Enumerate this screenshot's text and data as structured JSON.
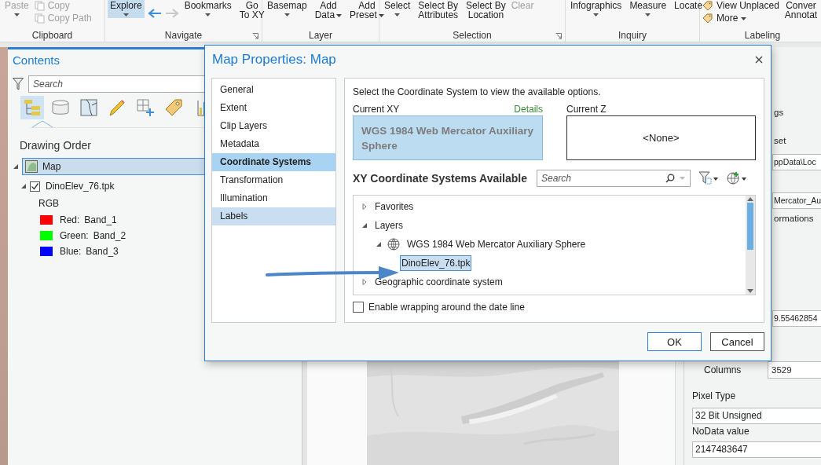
{
  "ribbon": {
    "groups": [
      {
        "label": "Clipboard",
        "launcher": false,
        "items": [
          {
            "kind": "menu",
            "label": "Paste",
            "disabled": true,
            "selected": false
          },
          {
            "kind": "stack",
            "entries": [
              {
                "kind": "button",
                "label": "Copy",
                "disabled": true
              },
              {
                "kind": "button",
                "label": "Copy Path",
                "disabled": true
              }
            ]
          }
        ]
      },
      {
        "label": "Navigate",
        "launcher": true,
        "items": [
          {
            "kind": "menu",
            "label": "Explore",
            "disabled": false,
            "selected": true
          },
          {
            "kind": "history",
            "back_disabled": false,
            "forward_disabled": true
          },
          {
            "kind": "menu",
            "label": "Bookmarks",
            "disabled": false,
            "selected": false
          },
          {
            "kind": "button",
            "label": "Go\nTo XY",
            "disabled": false,
            "selected": false
          }
        ]
      },
      {
        "label": "Layer",
        "launcher": false,
        "items": [
          {
            "kind": "menu",
            "label": "Basemap",
            "disabled": false,
            "selected": false
          },
          {
            "kind": "dropdown",
            "label": "Add\nData",
            "disabled": false,
            "selected": false
          },
          {
            "kind": "dropdown",
            "label": "Add\nPreset",
            "disabled": false,
            "selected": false
          }
        ]
      },
      {
        "label": "Selection",
        "launcher": true,
        "items": [
          {
            "kind": "menu",
            "label": "Select",
            "disabled": false,
            "selected": false
          },
          {
            "kind": "button",
            "label": "Select By\nAttributes",
            "disabled": false,
            "selected": false
          },
          {
            "kind": "button",
            "label": "Select By\nLocation",
            "disabled": false,
            "selected": false
          },
          {
            "kind": "stack",
            "entries": [
              {
                "kind": "button",
                "label": "Clear",
                "disabled": true
              }
            ]
          }
        ]
      },
      {
        "label": "Inquiry",
        "launcher": false,
        "items": [
          {
            "kind": "menu",
            "label": "Infographics",
            "disabled": false,
            "selected": false
          },
          {
            "kind": "menu",
            "label": "Measure",
            "disabled": false,
            "selected": false
          },
          {
            "kind": "button",
            "label": "Locate",
            "disabled": false,
            "selected": false
          }
        ]
      },
      {
        "label": "Labeling",
        "launcher": false,
        "items": [
          {
            "kind": "stack",
            "entries": [
              {
                "kind": "button",
                "label": "View Unplaced",
                "disabled": false
              },
              {
                "kind": "dropdown",
                "label": "More",
                "disabled": false
              }
            ]
          },
          {
            "kind": "button",
            "label": "Conver\nAnnotat",
            "disabled": false,
            "selected": false
          }
        ]
      }
    ]
  },
  "contents": {
    "title": "Contents",
    "search": {
      "placeholder": "Search"
    },
    "views": [
      {
        "kind": "drawing-order",
        "selected": true
      },
      {
        "kind": "data-source",
        "selected": false
      },
      {
        "kind": "selection",
        "selected": false
      },
      {
        "kind": "editing",
        "selected": false
      },
      {
        "kind": "snapping",
        "selected": false
      },
      {
        "kind": "labeling",
        "selected": false
      },
      {
        "kind": "charts",
        "selected": false
      }
    ],
    "heading": "Drawing Order",
    "map": {
      "label": "Map",
      "selected": true
    },
    "layer": {
      "label": "DinoElev_76.tpk",
      "checked": true,
      "expanded": true,
      "renderer": "RGB",
      "bands": [
        {
          "channel": "Red:",
          "band": "Band_1",
          "color": "#ff0000"
        },
        {
          "channel": "Green:",
          "band": "Band_2",
          "color": "#00ff00"
        },
        {
          "channel": "Blue:",
          "band": "Band_3",
          "color": "#0000ff"
        }
      ]
    }
  },
  "properties_pane": {
    "rows": [
      {
        "kind": "text",
        "text": "gs"
      },
      {
        "kind": "text",
        "text": "set"
      },
      {
        "kind": "field",
        "value": "ppData\\Loc"
      },
      {
        "kind": "field",
        "value": "Mercator_Au"
      },
      {
        "kind": "text",
        "text": "ormations"
      },
      {
        "kind": "field",
        "value": "9.55462854"
      },
      {
        "kind": "pair",
        "label": "Columns",
        "value": "3529"
      },
      {
        "kind": "label",
        "text": "Pixel Type"
      },
      {
        "kind": "wide-field",
        "value": "32 Bit Unsigned"
      },
      {
        "kind": "label",
        "text": "NoData value"
      },
      {
        "kind": "wide-field",
        "value": "2147483647"
      }
    ]
  },
  "dialog": {
    "title": "Map Properties: Map",
    "nav": [
      {
        "label": "General",
        "selected": false,
        "hovered": false
      },
      {
        "label": "Extent",
        "selected": false,
        "hovered": false
      },
      {
        "label": "Clip Layers",
        "selected": false,
        "hovered": false
      },
      {
        "label": "Metadata",
        "selected": false,
        "hovered": false
      },
      {
        "label": "Coordinate Systems",
        "selected": true,
        "hovered": false
      },
      {
        "label": "Transformation",
        "selected": false,
        "hovered": false
      },
      {
        "label": "Illumination",
        "selected": false,
        "hovered": false
      },
      {
        "label": "Labels",
        "selected": false,
        "hovered": true
      }
    ],
    "intro": "Select the Coordinate System to view the available options.",
    "current_xy": {
      "label": "Current XY",
      "link": "Details",
      "value": "WGS 1984 Web Mercator Auxiliary Sphere"
    },
    "current_z": {
      "label": "Current Z",
      "value": "<None>"
    },
    "available_heading": "XY Coordinate Systems Available",
    "search": {
      "placeholder": "Search"
    },
    "tree": [
      {
        "label": "Favorites",
        "expanded": false,
        "selected": false
      },
      {
        "label": "Layers",
        "expanded": true,
        "selected": false,
        "children": [
          {
            "label": "WGS 1984 Web Mercator Auxiliary Sphere",
            "kind": "projection",
            "expanded": true,
            "selected": false,
            "children": [
              {
                "label": "DinoElev_76.tpk",
                "selected": true
              }
            ]
          }
        ]
      },
      {
        "label": "Geographic coordinate system",
        "expanded": false,
        "selected": false
      }
    ],
    "wrap_dateline": {
      "label": "Enable wrapping around the date line",
      "checked": false
    },
    "buttons": [
      {
        "label": "OK",
        "kind": "primary"
      },
      {
        "label": "Cancel",
        "kind": "secondary"
      }
    ]
  }
}
